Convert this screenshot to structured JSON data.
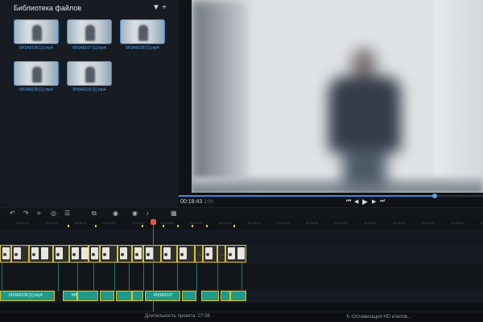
{
  "library": {
    "title": "Библиотека файлов",
    "filter_icon": "▼",
    "add_icon": "+",
    "files": [
      {
        "name": "6H3A9106 [1].mp4"
      },
      {
        "name": "6H3A9107 [1].mp4"
      },
      {
        "name": "6H3A9108 [1].mp4"
      },
      {
        "name": "6H3A9109 [1].mp4"
      },
      {
        "name": "6H3A9110 [1].mp4"
      }
    ]
  },
  "player": {
    "current_time": "00:18:43",
    "duration": "2:00",
    "progress": 0.84,
    "controls": {
      "skip_start": "⏮",
      "prev_frame": "◀",
      "play": "▶",
      "next_frame": "▶",
      "skip_end": "⏭"
    }
  },
  "toolbar": {
    "undo": "↶",
    "redo": "↷",
    "crop": "⌗",
    "color": "◎",
    "list": "☰",
    "copy": "⧉",
    "marker": "◉",
    "mic": "♪",
    "grid": "▦"
  },
  "ruler": {
    "ticks": [
      "00:00:00",
      "00:03:00",
      "00:06:00",
      "00:09:00",
      "00:12:00",
      "00:15:00",
      "00:18:00",
      "00:21:00",
      "00:24:00",
      "00:27:00",
      "00:30:00",
      "00:33:00",
      "00:36:00",
      "00:39:00",
      "00:42:00",
      "00:45:00",
      "00:48:00"
    ]
  },
  "timeline": {
    "audio_clips": [
      "6H3A9106 [1].mp4",
      "6H",
      "",
      "",
      "",
      "",
      "6H3A9107",
      "",
      "",
      "",
      ""
    ]
  },
  "status": {
    "project_duration": "Длительность проекта: 27:36",
    "optimization": "Оптимизация HD клипов..."
  },
  "colors": {
    "accent": "#3f8ad6",
    "clip_border": "#e0c227",
    "audio_clip": "#1f9a86",
    "playhead": "#d9463c"
  }
}
